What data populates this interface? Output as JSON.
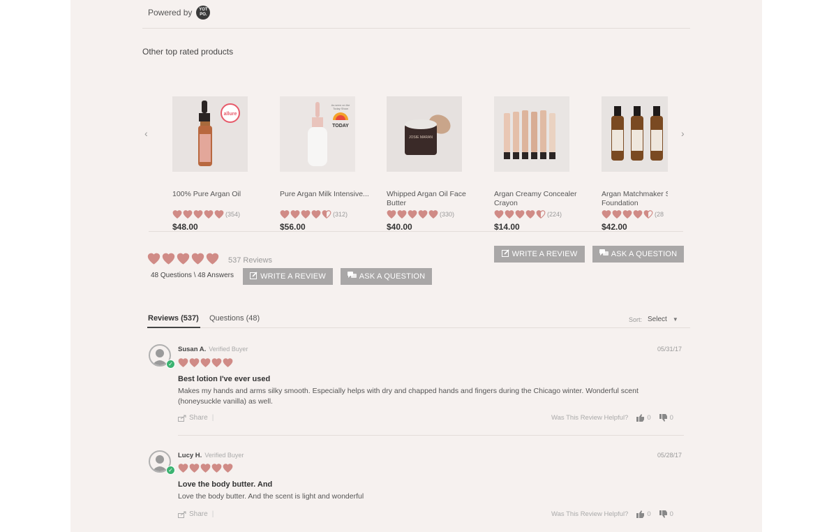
{
  "powered": {
    "label": "Powered by",
    "logo_text": "YOT\nPO."
  },
  "section_title": "Other top rated products",
  "carousel": {
    "prev_icon": "‹",
    "next_icon": "›",
    "products": [
      {
        "name": "100% Pure Argan Oil",
        "rating": 5,
        "count": "(354)",
        "price": "$48.00",
        "image": "dropper-bottle",
        "badge": ""
      },
      {
        "name": "Pure Argan Milk Intensive...",
        "rating": 4.5,
        "count": "(312)",
        "price": "$56.00",
        "image": "white-dropper",
        "badge": "TODAY"
      },
      {
        "name": "Whipped Argan Oil Face Butter",
        "rating": 5,
        "count": "(330)",
        "price": "$40.00",
        "image": "jar",
        "badge": ""
      },
      {
        "name": "Argan Creamy Concealer Crayon",
        "rating": 4.5,
        "count": "(224)",
        "price": "$14.00",
        "image": "crayons",
        "badge": ""
      },
      {
        "name": "Argan Matchmaker S Foundation",
        "rating": 4.5,
        "count": "(28",
        "price": "$42.00",
        "image": "amber-bottles",
        "badge": ""
      }
    ]
  },
  "summary": {
    "rating": 5,
    "reviews_label": "537 Reviews",
    "qa_label": "48 Questions \\ 48 Answers",
    "write_review": "WRITE A REVIEW",
    "ask_question": "ASK A QUESTION"
  },
  "tabs": {
    "reviews": "Reviews (537)",
    "questions": "Questions (48)"
  },
  "sort": {
    "label": "Sort:",
    "value": "Select"
  },
  "reviews": [
    {
      "name": "Susan A.",
      "badge": "Verified Buyer",
      "date": "05/31/17",
      "rating": 5,
      "title": "Best lotion I've ever used",
      "body": "Makes my hands and arms silky smooth. Especially helps with dry and chapped hands and fingers during the Chicago winter. Wonderful scent (honeysuckle vanilla) as well.",
      "share": "Share",
      "helpful_label": "Was This Review Helpful?",
      "up": "0",
      "down": "0"
    },
    {
      "name": "Lucy H.",
      "badge": "Verified Buyer",
      "date": "05/28/17",
      "rating": 5,
      "title": "Love the body butter. And",
      "body": "Love the body butter. And the scent is light and wonderful",
      "share": "Share",
      "helpful_label": "Was This Review Helpful?",
      "up": "0",
      "down": "0"
    }
  ],
  "colors": {
    "page_bg": "#f6f1ef",
    "heart": "#d08b86",
    "button": "#a9a7a7",
    "verified": "#3cb371"
  }
}
